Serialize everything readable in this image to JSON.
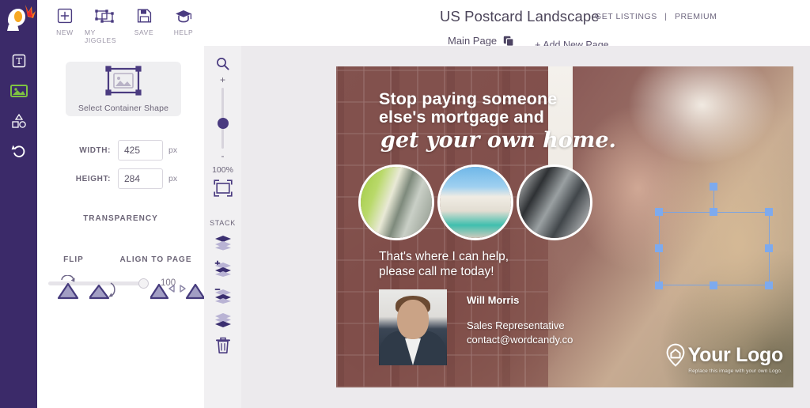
{
  "brand": {
    "logo_name": "jiggle-megaphone-logo"
  },
  "rail": {
    "tools": [
      {
        "name": "text-tool",
        "icon": "text-box-icon"
      },
      {
        "name": "image-tool",
        "icon": "image-icon"
      },
      {
        "name": "shapes-tool",
        "icon": "shapes-icon"
      },
      {
        "name": "undo-tool",
        "icon": "undo-arrow-icon"
      }
    ]
  },
  "toolbar": {
    "items": [
      {
        "label": "NEW",
        "icon": "plus-square-icon"
      },
      {
        "label": "MY JIGGLES",
        "icon": "jiggles-frame-icon"
      },
      {
        "label": "SAVE",
        "icon": "floppy-disk-icon"
      },
      {
        "label": "HELP",
        "icon": "graduation-cap-icon"
      }
    ]
  },
  "header": {
    "title": "US Postcard Landscape",
    "get_listings": "GET LISTINGS",
    "separator": "|",
    "premium": "PREMIUM"
  },
  "tabs": {
    "main_page": "Main Page",
    "duplicate_icon": "duplicate-pages-icon",
    "add_new_page": "+ Add New Page"
  },
  "properties": {
    "shape_button_label": "Select Container Shape",
    "shape_button_icon": "image-placeholder-with-handles-icon",
    "width_label": "WIDTH:",
    "width_value": "425",
    "width_unit": "px",
    "height_label": "HEIGHT:",
    "height_value": "284",
    "height_unit": "px",
    "transparency_label": "TRANSPARENCY",
    "transparency_value": "100",
    "flip_label": "FLIP",
    "align_label": "ALIGN TO PAGE",
    "flip_buttons": [
      {
        "name": "flip-vertical-button",
        "icon": "flip-vertical-icon"
      },
      {
        "name": "flip-horizontal-button",
        "icon": "flip-horizontal-icon"
      }
    ],
    "align_buttons": [
      {
        "name": "align-left-button",
        "icon": "align-left-icon"
      },
      {
        "name": "align-center-button",
        "icon": "align-center-icon"
      },
      {
        "name": "align-right-button",
        "icon": "align-right-icon"
      }
    ]
  },
  "canvas_tools": {
    "search_icon": "magnifier-icon",
    "zoom_in": "+",
    "zoom_out": "-",
    "zoom_level": "100%",
    "fit_icon": "fit-to-screen-icon",
    "stack_label": "STACK",
    "stack_items": [
      {
        "name": "bring-to-front-button",
        "icon": "stack-top-icon"
      },
      {
        "name": "bring-forward-button",
        "icon": "stack-up-icon"
      },
      {
        "name": "send-backward-button",
        "icon": "stack-down-icon"
      },
      {
        "name": "send-to-back-button",
        "icon": "stack-bottom-icon"
      },
      {
        "name": "delete-button",
        "icon": "trash-icon"
      }
    ]
  },
  "postcard": {
    "headline_line1": "Stop paying someone",
    "headline_line2": "else's mortgage and",
    "headline_script": "get your own home.",
    "circles": [
      {
        "name": "circle-image-keys",
        "alt": "keys-in-door"
      },
      {
        "name": "circle-image-house",
        "alt": "modern-house-with-pool"
      },
      {
        "name": "circle-image-kitchen",
        "alt": "kitchen-interior"
      }
    ],
    "tagline_line1": "That's where I can help,",
    "tagline_line2": "please call me today!",
    "agent_name": "Will Morris",
    "agent_role": "Sales Representative",
    "agent_email": "contact@wordcandy.co",
    "logo_text": "Your Logo",
    "logo_icon": "home-pin-icon",
    "logo_sub": "Replace this image with your own Logo."
  },
  "colors": {
    "rail": "#3b2a69",
    "accent_purple": "#4a3b80",
    "panel_bg": "#ffffff",
    "canvas_bg": "#eceaed",
    "selection_blue": "#7daaee",
    "muted_text": "#6d6678"
  }
}
